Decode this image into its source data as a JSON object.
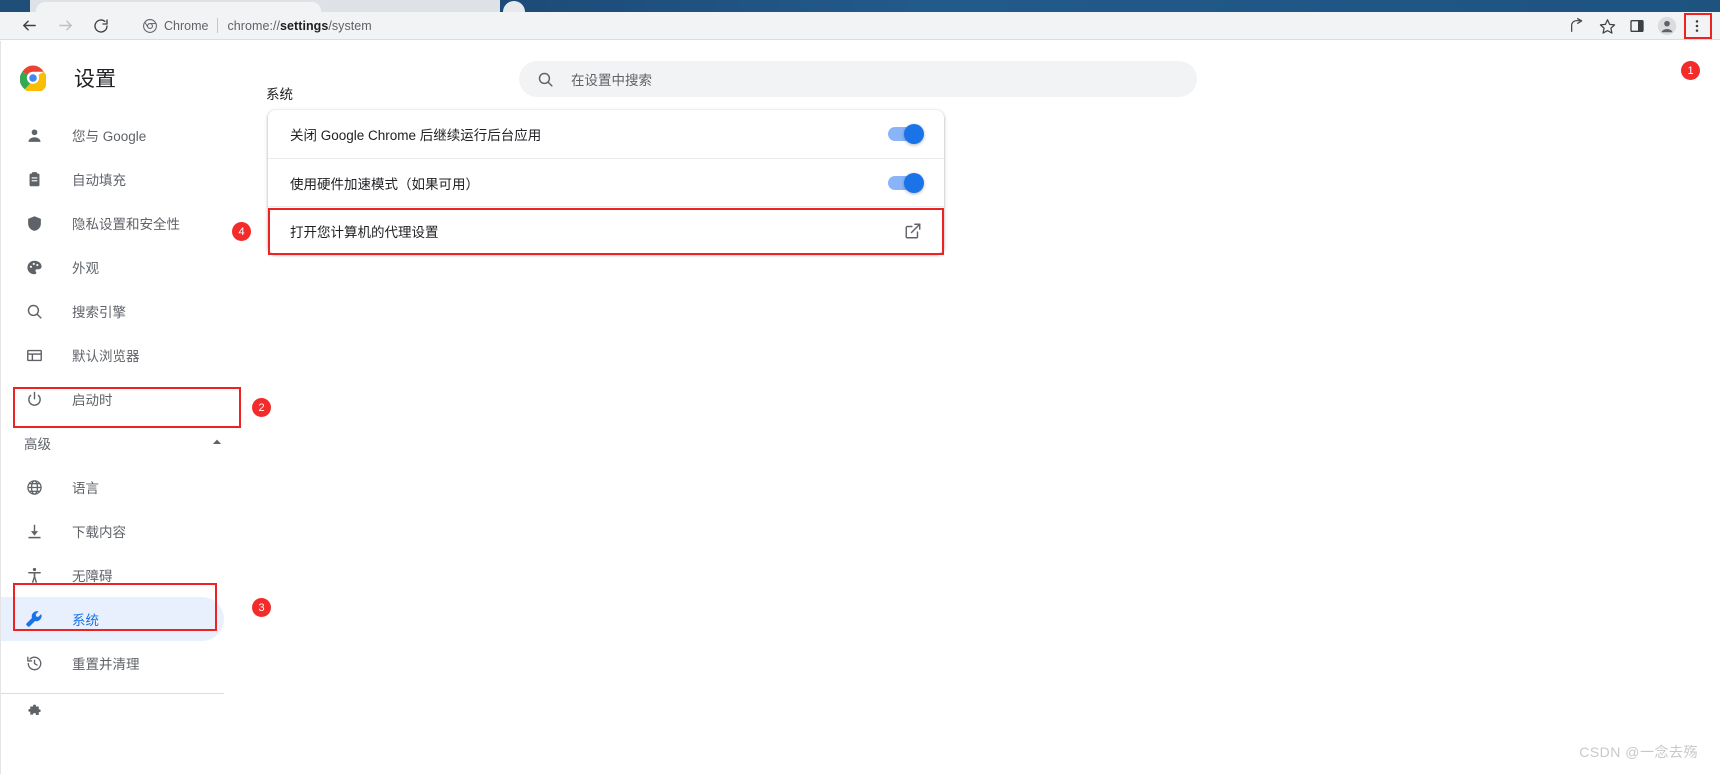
{
  "browser": {
    "omnibox": {
      "site_label": "Chrome",
      "url_prefix": "chrome://",
      "url_bold": "settings",
      "url_suffix": "/system",
      "chrome_icon": "chrome-logo-icon"
    },
    "nav": {
      "back": "back-arrow-icon",
      "forward": "forward-arrow-icon",
      "reload": "reload-icon"
    },
    "toolbar_icons": [
      {
        "name": "share-icon",
        "label": "分享"
      },
      {
        "name": "bookmark-star-icon",
        "label": "收藏"
      },
      {
        "name": "side-panel-icon",
        "label": "侧边栏"
      },
      {
        "name": "profile-avatar-icon",
        "label": "个人资料"
      },
      {
        "name": "three-dot-menu-icon",
        "label": "自定义及控制 Google Chrome"
      }
    ]
  },
  "settings": {
    "title": "设置",
    "logo": "chrome-logo-icon",
    "search": {
      "placeholder": "在设置中搜索",
      "icon": "search-icon"
    }
  },
  "sidebar": {
    "items": [
      {
        "icon": "person-icon",
        "label": "您与 Google",
        "selected": false
      },
      {
        "icon": "clipboard-icon",
        "label": "自动填充",
        "selected": false
      },
      {
        "icon": "shield-icon",
        "label": "隐私设置和安全性",
        "selected": false
      },
      {
        "icon": "palette-icon",
        "label": "外观",
        "selected": false
      },
      {
        "icon": "search-icon",
        "label": "搜索引擎",
        "selected": false
      },
      {
        "icon": "browser-window-icon",
        "label": "默认浏览器",
        "selected": false
      },
      {
        "icon": "power-icon",
        "label": "启动时",
        "selected": false
      }
    ],
    "advanced": {
      "label": "高级",
      "expanded": true,
      "arrow_icon": "chevron-up-icon"
    },
    "advanced_items": [
      {
        "icon": "globe-icon",
        "label": "语言",
        "selected": false
      },
      {
        "icon": "download-icon",
        "label": "下载内容",
        "selected": false
      },
      {
        "icon": "accessibility-icon",
        "label": "无障碍",
        "selected": false
      },
      {
        "icon": "wrench-icon",
        "label": "系统",
        "selected": true
      },
      {
        "icon": "restore-icon",
        "label": "重置并清理",
        "selected": false
      }
    ]
  },
  "main": {
    "section_title": "系统",
    "rows": [
      {
        "label": "关闭 Google Chrome 后继续运行后台应用",
        "control": "toggle",
        "toggle_on": true
      },
      {
        "label": "使用硬件加速模式（如果可用）",
        "control": "toggle",
        "toggle_on": true
      },
      {
        "label": "打开您计算机的代理设置",
        "control": "external-link",
        "icon": "external-link-icon"
      }
    ]
  },
  "annotations": {
    "badges": [
      {
        "number": "1",
        "target": "three-dot-menu-icon"
      },
      {
        "number": "2",
        "target": "advanced-row"
      },
      {
        "number": "3",
        "target": "sidebar-item-system"
      },
      {
        "number": "4",
        "target": "proxy-settings-row"
      }
    ],
    "color": "#f32b2b"
  },
  "watermark": {
    "text": "CSDN @一念去殇"
  },
  "colors": {
    "accent_blue": "#1a73e8",
    "toggle_track": "#8ab4f8",
    "selected_bg": "#e8f0fe",
    "annotation_red": "#ee2222",
    "text_primary": "#202124",
    "text_secondary": "#5f6368"
  }
}
